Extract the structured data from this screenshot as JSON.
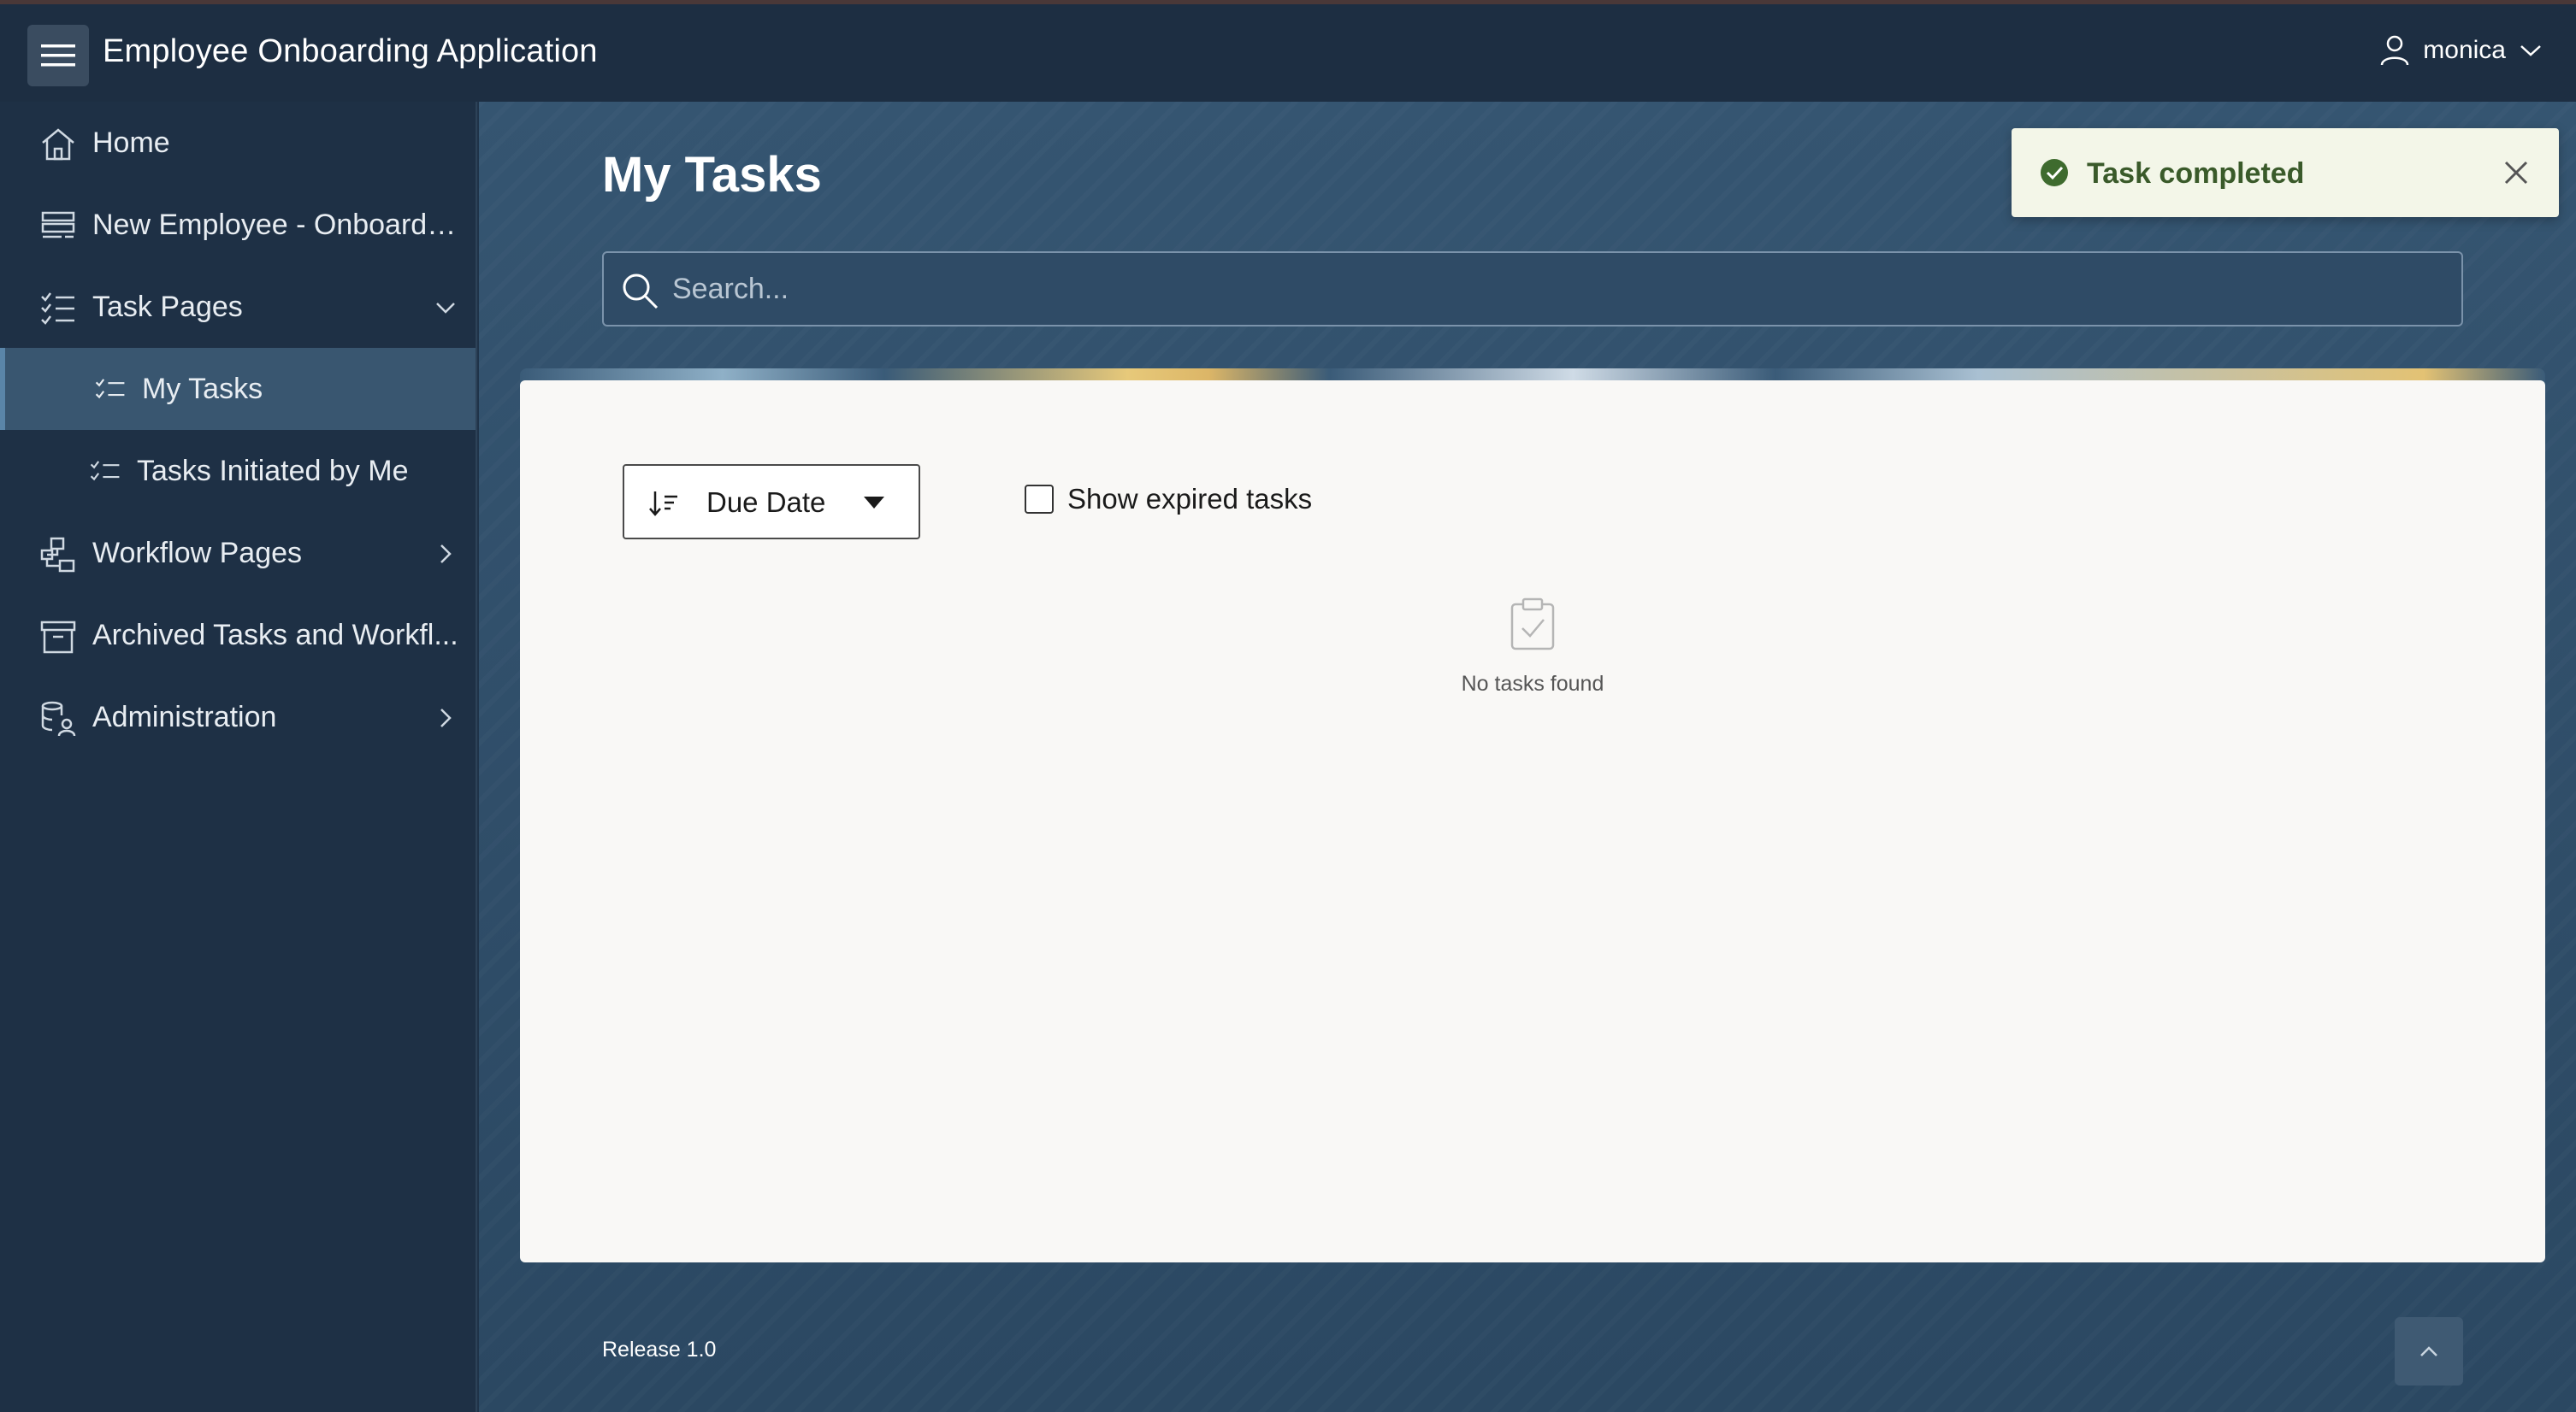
{
  "header": {
    "app_title": "Employee Onboarding Application",
    "user_name": "monica"
  },
  "sidebar": {
    "items": [
      {
        "label": "Home",
        "icon": "home-icon"
      },
      {
        "label": "New Employee - Onboarding",
        "icon": "form-icon"
      },
      {
        "label": "Task Pages",
        "icon": "task-list-icon",
        "expanded": true
      },
      {
        "label": "My Tasks",
        "icon": "task-list-icon",
        "active": true
      },
      {
        "label": "Tasks Initiated by Me",
        "icon": "task-list-icon"
      },
      {
        "label": "Workflow Pages",
        "icon": "workflow-icon"
      },
      {
        "label": "Archived Tasks and Workfl...",
        "icon": "archive-icon"
      },
      {
        "label": "Administration",
        "icon": "admin-icon"
      }
    ]
  },
  "main": {
    "page_title": "My Tasks",
    "search_placeholder": "Search...",
    "sort_label": "Due Date",
    "show_expired_label": "Show expired tasks",
    "show_expired_checked": false,
    "empty_message": "No tasks found",
    "footer": "Release 1.0"
  },
  "toast": {
    "message": "Task completed"
  },
  "colors": {
    "header_bg": "#1d2e42",
    "sidebar_bg": "#1e3045",
    "active_item_bg": "#395670",
    "card_bg": "#f9f8f6",
    "toast_bg": "#f3f6e8",
    "success_green": "#3e6b2e"
  }
}
